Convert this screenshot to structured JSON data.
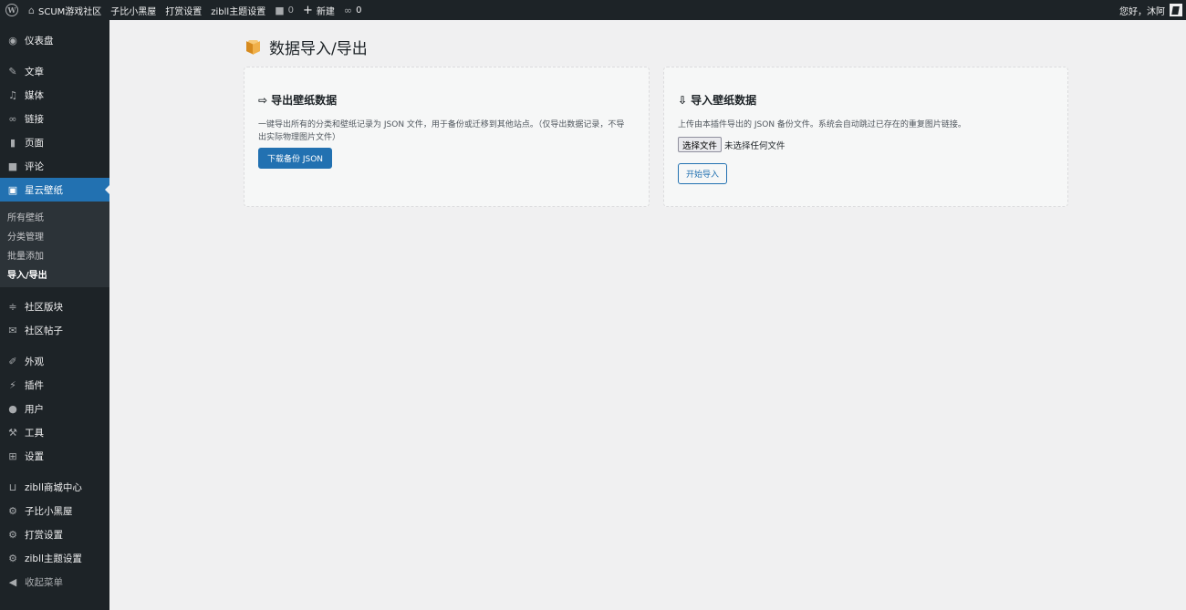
{
  "adminbar": {
    "site_name": "SCUM游戏社区",
    "links": [
      "子比小黑屋",
      "打赏设置",
      "zibll主题设置"
    ],
    "comments_count": "0",
    "new_label": "新建",
    "link_count": "0",
    "greeting": "您好，沐阿"
  },
  "sidebar": {
    "dashboard": "仪表盘",
    "posts": "文章",
    "media": "媒体",
    "links": "链接",
    "pages": "页面",
    "comments": "评论",
    "current": "星云壁纸",
    "submenu": [
      "所有壁纸",
      "分类管理",
      "批量添加",
      "导入/导出"
    ],
    "forum_blocks": "社区版块",
    "forum_posts": "社区帖子",
    "appearance": "外观",
    "plugins": "插件",
    "users": "用户",
    "tools": "工具",
    "settings": "设置",
    "zibll_shop": "zibll商城中心",
    "zibi_room": "子比小黑屋",
    "reward_settings": "打赏设置",
    "zibll_theme": "zibll主题设置",
    "collapse": "收起菜单"
  },
  "page": {
    "title": "数据导入/导出"
  },
  "export_card": {
    "title": "导出壁纸数据",
    "description": "一键导出所有的分类和壁纸记录为 JSON 文件，用于备份或迁移到其他站点。（仅导出数据记录，不导出实际物理图片文件）",
    "button": "下载备份 JSON"
  },
  "import_card": {
    "title": "导入壁纸数据",
    "description": "上传由本插件导出的 JSON 备份文件。系统会自动跳过已存在的重复图片链接。",
    "file_button": "选择文件",
    "file_status": "未选择任何文件",
    "button": "开始导入"
  }
}
